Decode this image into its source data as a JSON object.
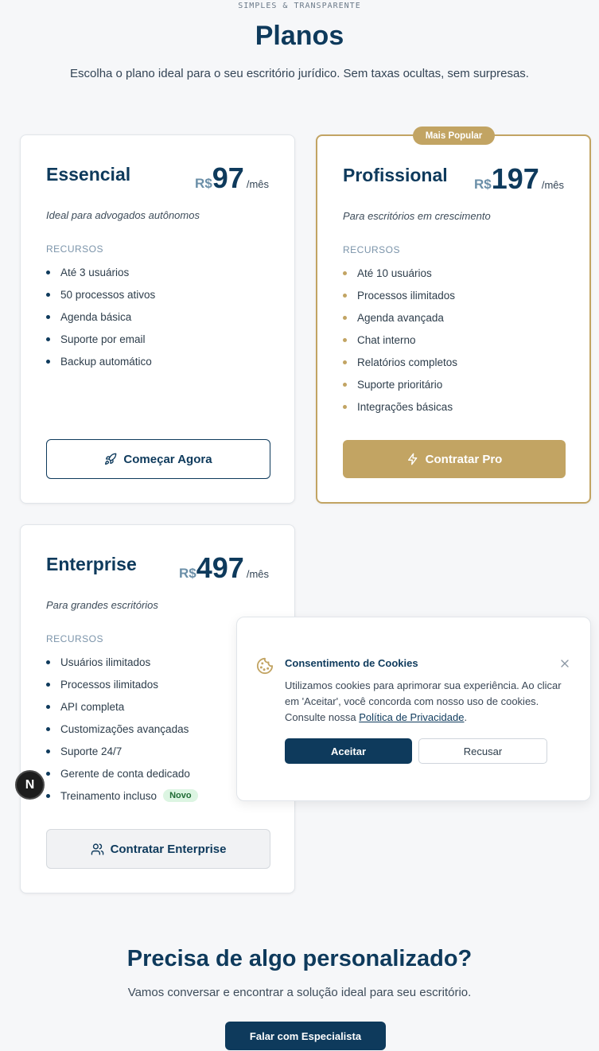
{
  "header": {
    "eyebrow": "SIMPLES & TRANSPARENTE",
    "title": "Planos",
    "subtitle": "Escolha o plano ideal para o seu escritório jurídico. Sem taxas ocultas, sem surpresas."
  },
  "plans": [
    {
      "name": "Essencial",
      "currency": "R$",
      "price": "97",
      "period": "/mês",
      "description": "Ideal para advogados autônomos",
      "resources_label": "RECURSOS",
      "features": [
        "Até 3 usuários",
        "50 processos ativos",
        "Agenda básica",
        "Suporte por email",
        "Backup automático"
      ],
      "cta": "Começar Agora",
      "cta_icon": "rocket-icon"
    },
    {
      "name": "Profissional",
      "badge": "Mais Popular",
      "currency": "R$",
      "price": "197",
      "period": "/mês",
      "description": "Para escritórios em crescimento",
      "resources_label": "RECURSOS",
      "features": [
        "Até 10 usuários",
        "Processos ilimitados",
        "Agenda avançada",
        "Chat interno",
        "Relatórios completos",
        "Suporte prioritário",
        "Integrações básicas"
      ],
      "cta": "Contratar Pro",
      "cta_icon": "lightning-icon"
    },
    {
      "name": "Enterprise",
      "currency": "R$",
      "price": "497",
      "period": "/mês",
      "description": "Para grandes escritórios",
      "resources_label": "RECURSOS",
      "features": [
        "Usuários ilimitados",
        "Processos ilimitados",
        "API completa",
        "Customizações avançadas",
        "Suporte 24/7",
        "Gerente de conta dedicado",
        "Treinamento incluso"
      ],
      "new_badge": "Novo",
      "cta": "Contratar Enterprise",
      "cta_icon": "users-icon"
    }
  ],
  "cookie": {
    "title": "Consentimento de Cookies",
    "text_before_link": "Utilizamos cookies para aprimorar sua experiência. Ao clicar em 'Aceitar', você concorda com nosso uso de cookies. Consulte nossa ",
    "link_text": "Política de Privacidade",
    "text_after_link": ".",
    "accept": "Aceitar",
    "decline": "Recusar"
  },
  "avatar": {
    "letter": "N"
  },
  "cta_section": {
    "title": "Precisa de algo personalizado?",
    "subtitle": "Vamos conversar e encontrar a solução ideal para seu escritório.",
    "button": "Falar com Especialista"
  },
  "colors": {
    "primary": "#0e3a5c",
    "gold": "#c2a463",
    "background": "#f6f7f9",
    "new_badge_bg": "#dcf5e2"
  }
}
